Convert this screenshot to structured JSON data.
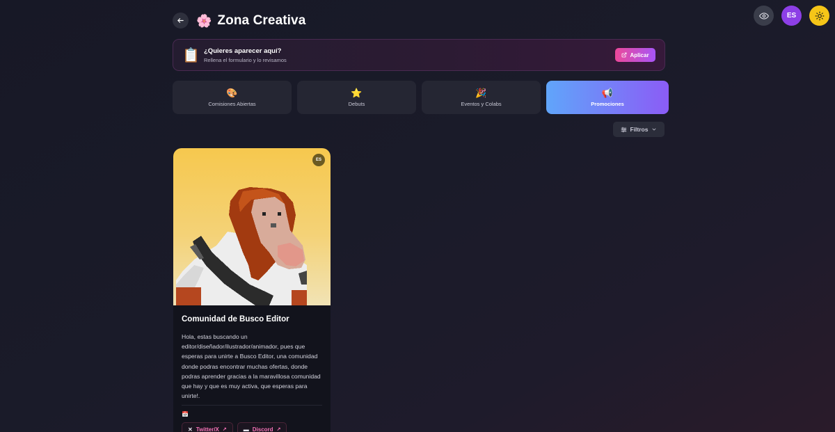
{
  "header": {
    "title": "Zona Creativa",
    "title_icon": "🌸",
    "back_icon": "arrow-left-icon"
  },
  "top_actions": {
    "language": "ES",
    "eye_icon": "eye-icon",
    "theme_icon": "sun-icon"
  },
  "banner": {
    "icon": "📋",
    "title": "¿Quieres aparecer aquí?",
    "subtitle": "Rellena el formulario y lo revisamos",
    "button_label": "Aplicar",
    "button_icon": "external-link-icon"
  },
  "tabs": [
    {
      "icon": "🎨",
      "label": "Comisiones Abiertas",
      "active": false
    },
    {
      "icon": "⭐",
      "label": "Debuts",
      "active": false
    },
    {
      "icon": "🎉",
      "label": "Eventos y Colabs",
      "active": false
    },
    {
      "icon": "📢",
      "label": "Promociones",
      "active": true
    }
  ],
  "filters": {
    "label": "Filtros",
    "icon": "sliders-icon"
  },
  "card": {
    "language": "ES",
    "title": "Comunidad de Busco Editor",
    "description": "Hola, estas buscando un editor/diseñador/ilustrador/animador, pues que esperas para unirte a Busco Editor, una comunidad donde podras encontrar muchas ofertas, donde podras aprender gracias a la maravillosa comunidad que hay y que es muy activa, que esperas para unirte!.",
    "date_icon": "📅",
    "links": [
      {
        "label": "Twitter/X",
        "icon": "x-icon"
      },
      {
        "label": "Discord",
        "icon": "discord-icon"
      }
    ]
  },
  "colors": {
    "accent_pink": "#ec4899",
    "accent_purple": "#8b5cf6",
    "accent_blue": "#60a5fa",
    "background": "#171826",
    "card_yellow": "#f6c84e"
  }
}
